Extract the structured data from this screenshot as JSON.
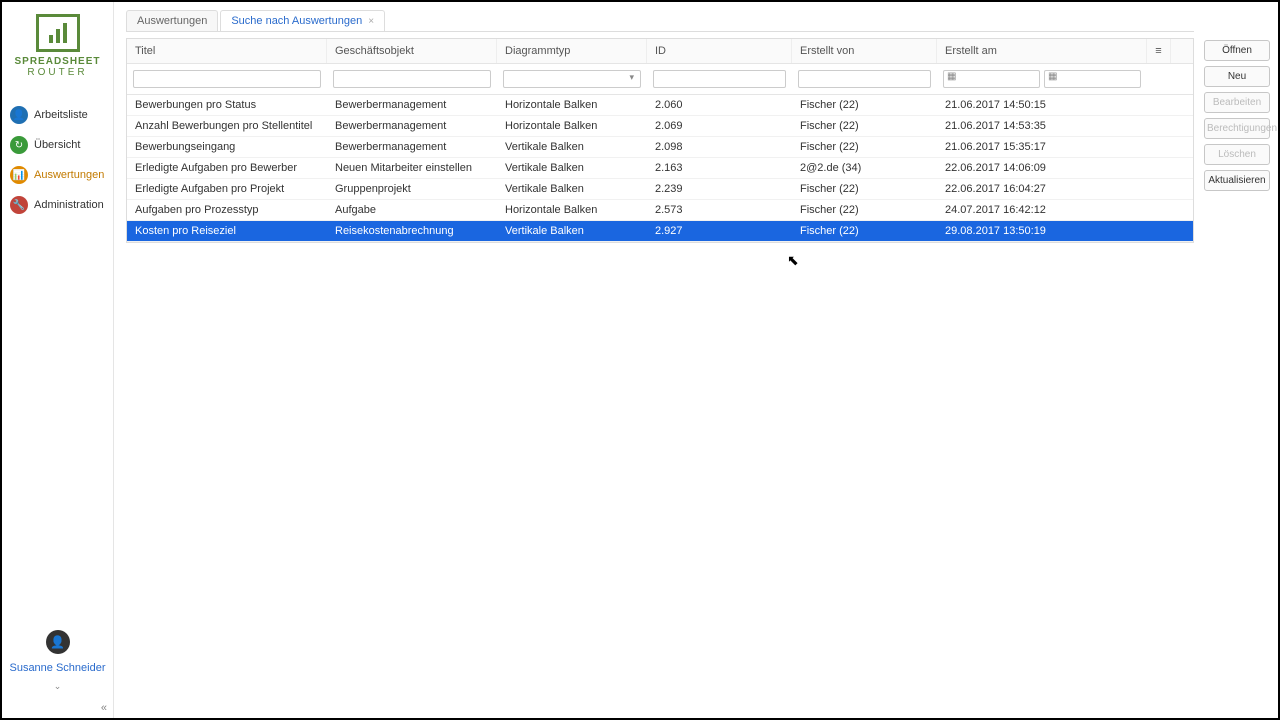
{
  "brand": {
    "line1": "SPREADSHEET",
    "line2": "ROUTER"
  },
  "nav": {
    "items": [
      {
        "label": "Arbeitsliste",
        "iconClass": "ic-blue",
        "glyph": "👤"
      },
      {
        "label": "Übersicht",
        "iconClass": "ic-green",
        "glyph": "↻"
      },
      {
        "label": "Auswertungen",
        "iconClass": "ic-orange",
        "glyph": "📊",
        "active": true
      },
      {
        "label": "Administration",
        "iconClass": "ic-red",
        "glyph": "🔧"
      }
    ]
  },
  "user": {
    "name": "Susanne Schneider"
  },
  "tabs": [
    {
      "label": "Auswertungen",
      "active": false,
      "closable": false
    },
    {
      "label": "Suche nach Auswertungen",
      "active": true,
      "closable": true
    }
  ],
  "grid": {
    "columns": [
      "Titel",
      "Geschäftsobjekt",
      "Diagrammtyp",
      "ID",
      "Erstellt von",
      "Erstellt am"
    ],
    "rows": [
      {
        "titel": "Bewerbungen pro Status",
        "obj": "Bewerbermanagement",
        "typ": "Horizontale Balken",
        "id": "2.060",
        "von": "Fischer (22)",
        "am": "21.06.2017 14:50:15"
      },
      {
        "titel": "Anzahl Bewerbungen pro Stellentitel",
        "obj": "Bewerbermanagement",
        "typ": "Horizontale Balken",
        "id": "2.069",
        "von": "Fischer (22)",
        "am": "21.06.2017 14:53:35"
      },
      {
        "titel": "Bewerbungseingang",
        "obj": "Bewerbermanagement",
        "typ": "Vertikale Balken",
        "id": "2.098",
        "von": "Fischer (22)",
        "am": "21.06.2017 15:35:17"
      },
      {
        "titel": "Erledigte Aufgaben pro Bewerber",
        "obj": "Neuen Mitarbeiter einstellen",
        "typ": "Vertikale Balken",
        "id": "2.163",
        "von": "2@2.de (34)",
        "am": "22.06.2017 14:06:09"
      },
      {
        "titel": "Erledigte Aufgaben pro Projekt",
        "obj": "Gruppenprojekt",
        "typ": "Vertikale Balken",
        "id": "2.239",
        "von": "Fischer (22)",
        "am": "22.06.2017 16:04:27"
      },
      {
        "titel": "Aufgaben pro Prozesstyp",
        "obj": "Aufgabe",
        "typ": "Horizontale Balken",
        "id": "2.573",
        "von": "Fischer (22)",
        "am": "24.07.2017 16:42:12"
      },
      {
        "titel": "Kosten pro Reiseziel",
        "obj": "Reisekostenabrechnung",
        "typ": "Vertikale Balken",
        "id": "2.927",
        "von": "Fischer (22)",
        "am": "29.08.2017 13:50:19",
        "selected": true
      }
    ]
  },
  "actions": {
    "open": "Öffnen",
    "new": "Neu",
    "edit": "Bearbeiten",
    "perm": "Berechtigungen",
    "delete": "Löschen",
    "refresh": "Aktualisieren"
  }
}
